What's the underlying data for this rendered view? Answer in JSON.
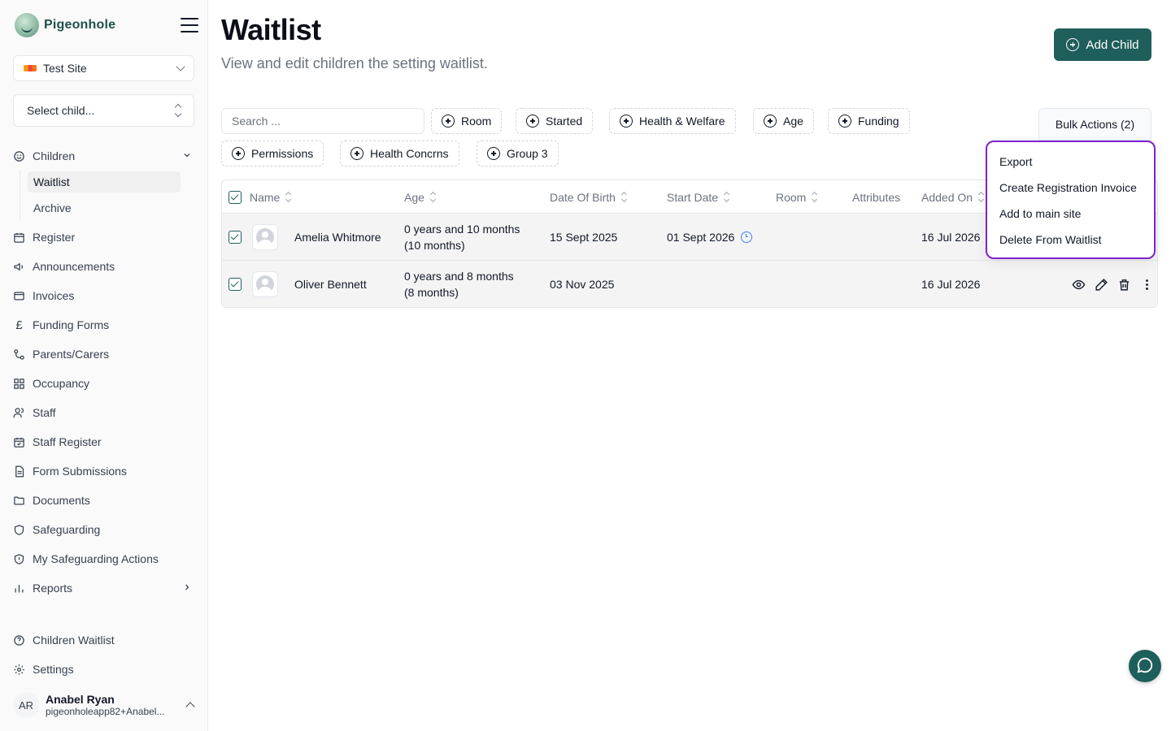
{
  "app": {
    "brand": "Pigeonhole"
  },
  "sidebar": {
    "site": "Test Site",
    "child_select": "Select child...",
    "nav": [
      {
        "label": "Children",
        "icon": "children-icon"
      },
      {
        "label": "Waitlist",
        "active": true
      },
      {
        "label": "Archive"
      },
      {
        "label": "Register",
        "icon": "calendar-icon"
      },
      {
        "label": "Announcements",
        "icon": "megaphone-icon"
      },
      {
        "label": "Invoices",
        "icon": "invoice-icon"
      },
      {
        "label": "Funding Forms",
        "icon": "pound-icon"
      },
      {
        "label": "Parents/Carers",
        "icon": "parents-icon"
      },
      {
        "label": "Occupancy",
        "icon": "grid-icon"
      },
      {
        "label": "Staff",
        "icon": "staff-icon"
      },
      {
        "label": "Staff Register",
        "icon": "calendar-check-icon"
      },
      {
        "label": "Form Submissions",
        "icon": "form-icon"
      },
      {
        "label": "Documents",
        "icon": "folder-icon"
      },
      {
        "label": "Safeguarding",
        "icon": "shield-icon"
      },
      {
        "label": "My Safeguarding Actions",
        "icon": "shield-alert-icon"
      },
      {
        "label": "Reports",
        "icon": "bar-chart-icon"
      },
      {
        "label": "Children Waitlist",
        "icon": "help-circle-icon"
      },
      {
        "label": "Settings",
        "icon": "gear-icon"
      }
    ],
    "user": {
      "initials": "AR",
      "name": "Anabel Ryan",
      "email": "pigeonholeapp82+Anabel..."
    }
  },
  "header": {
    "title": "Waitlist",
    "subtitle": "View and edit children the setting waitlist.",
    "add_child": "Add Child"
  },
  "filters": {
    "search_placeholder": "Search ...",
    "chips": [
      "Room",
      "Started",
      "Health & Welfare",
      "Age",
      "Funding",
      "Permissions",
      "Health Concrns",
      "Group 3"
    ],
    "bulk_actions": "Bulk Actions (2)"
  },
  "table": {
    "columns": [
      "Name",
      "Age",
      "Date Of Birth",
      "Start Date",
      "Room",
      "Attributes",
      "Added On"
    ],
    "rows": [
      {
        "name": "Amelia Whitmore",
        "age_line1": "0 years and 10 months",
        "age_line2": "(10 months)",
        "dob": "15 Sept 2025",
        "start": "01 Sept 2026",
        "room": "",
        "attributes": "",
        "added": "16 Jul 2026",
        "checked": true
      },
      {
        "name": "Oliver Bennett",
        "age_line1": "0 years and 8 months",
        "age_line2": "(8 months)",
        "dob": "03 Nov 2025",
        "start": "",
        "room": "",
        "attributes": "",
        "added": "16 Jul 2026",
        "checked": true
      }
    ]
  },
  "bulk_menu": [
    "Export",
    "Create Registration Invoice",
    "Add to main site",
    "Delete From Waitlist"
  ],
  "colors": {
    "brand": "#1f5f5b",
    "menu_highlight": "#7e22ce",
    "clock": "#3b82f6"
  }
}
